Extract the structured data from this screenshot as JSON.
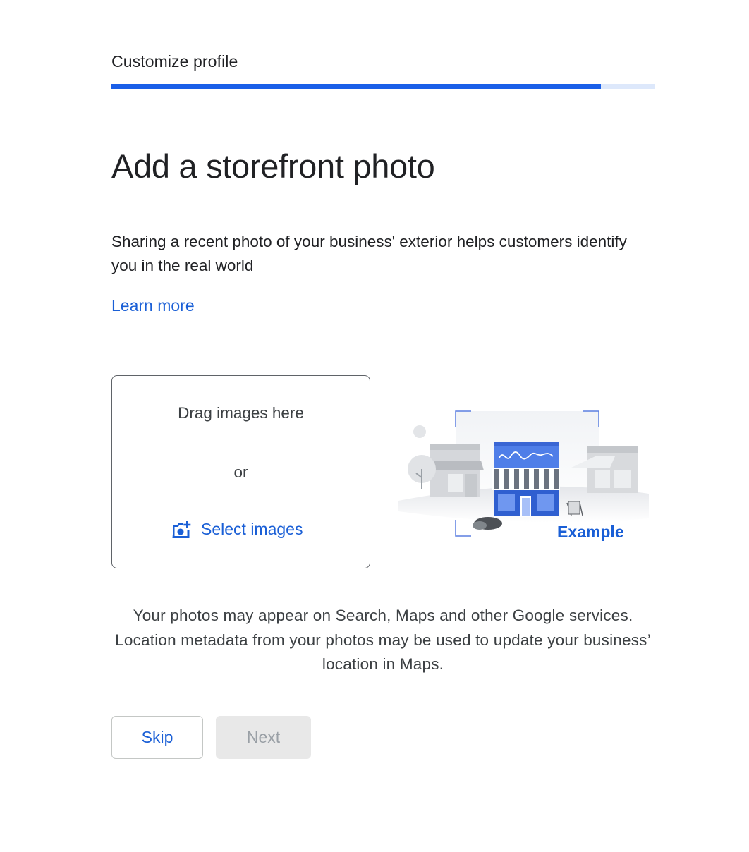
{
  "header": {
    "section_label": "Customize profile",
    "progress_percent": 90,
    "progress_color": "#1a5fe8",
    "progress_track_color": "#dde8fb"
  },
  "main": {
    "title": "Add a storefront photo",
    "description": "Sharing a recent photo of your business' exterior helps customers identify you in the real world",
    "learn_more": "Learn more"
  },
  "dropzone": {
    "drag_text": "Drag images here",
    "or_text": "or",
    "select_label": "Select images",
    "select_icon": "add-photo-camera-icon"
  },
  "example": {
    "label": "Example",
    "illustration": "storefront-illustration"
  },
  "disclaimer": "Your photos may appear on Search, Maps and other Google services. Location metadata from your photos may be used to update your business’ location in Maps.",
  "actions": {
    "skip_label": "Skip",
    "next_label": "Next",
    "next_disabled": true
  },
  "colors": {
    "link": "#1a5fd6",
    "accent": "#1a5fe8"
  }
}
